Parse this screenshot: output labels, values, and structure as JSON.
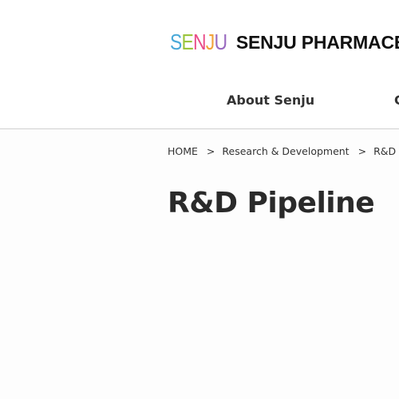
{
  "header": {
    "logo_mark": {
      "letters": [
        {
          "char": "S",
          "color": "#4aa9d8"
        },
        {
          "char": "E",
          "color": "#9bc53d"
        },
        {
          "char": "N",
          "color": "#e94e8a"
        },
        {
          "char": "J",
          "color": "#f2a33a"
        },
        {
          "char": "U",
          "color": "#9a6bc0"
        }
      ]
    },
    "company_name": "SENJU PHARMACE",
    "nav": {
      "about": "About Senju",
      "next": "C"
    }
  },
  "breadcrumb": {
    "home": "HOME",
    "separator": ">",
    "section": "Research & Development",
    "current": "R&D Pipel"
  },
  "main": {
    "title": "R&D Pipeline"
  }
}
